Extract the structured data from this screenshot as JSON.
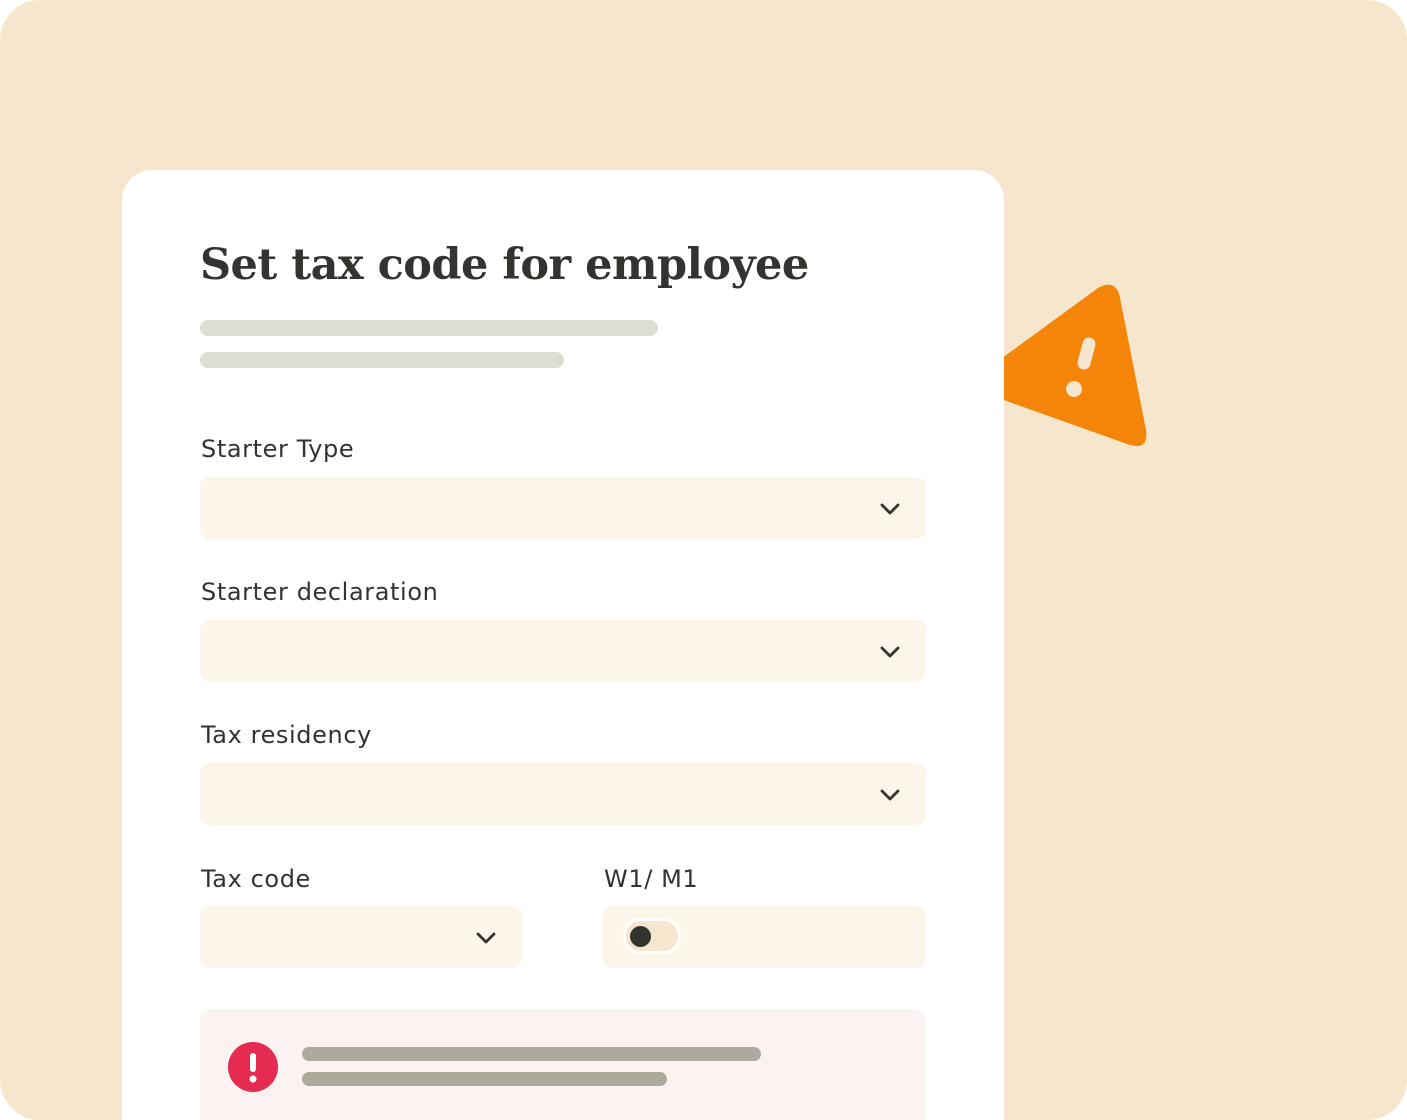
{
  "form": {
    "title": "Set tax code for employee",
    "fields": {
      "starter_type": {
        "label": "Starter Type",
        "value": ""
      },
      "starter_declaration": {
        "label": "Starter declaration",
        "value": ""
      },
      "tax_residency": {
        "label": "Tax residency",
        "value": ""
      },
      "tax_code": {
        "label": "Tax code",
        "value": ""
      },
      "w1_m1": {
        "label": "W1/ M1",
        "enabled": false
      }
    }
  },
  "icons": {
    "dropdown": "chevron-down-icon",
    "warning": "warning-triangle-icon",
    "error": "error-exclamation-icon"
  },
  "colors": {
    "background": "#f6e6cd",
    "card": "#ffffff",
    "field": "#fcf5e9",
    "warning": "#f58508",
    "error": "#e52b50",
    "alert_bg": "#fdf2f2"
  }
}
